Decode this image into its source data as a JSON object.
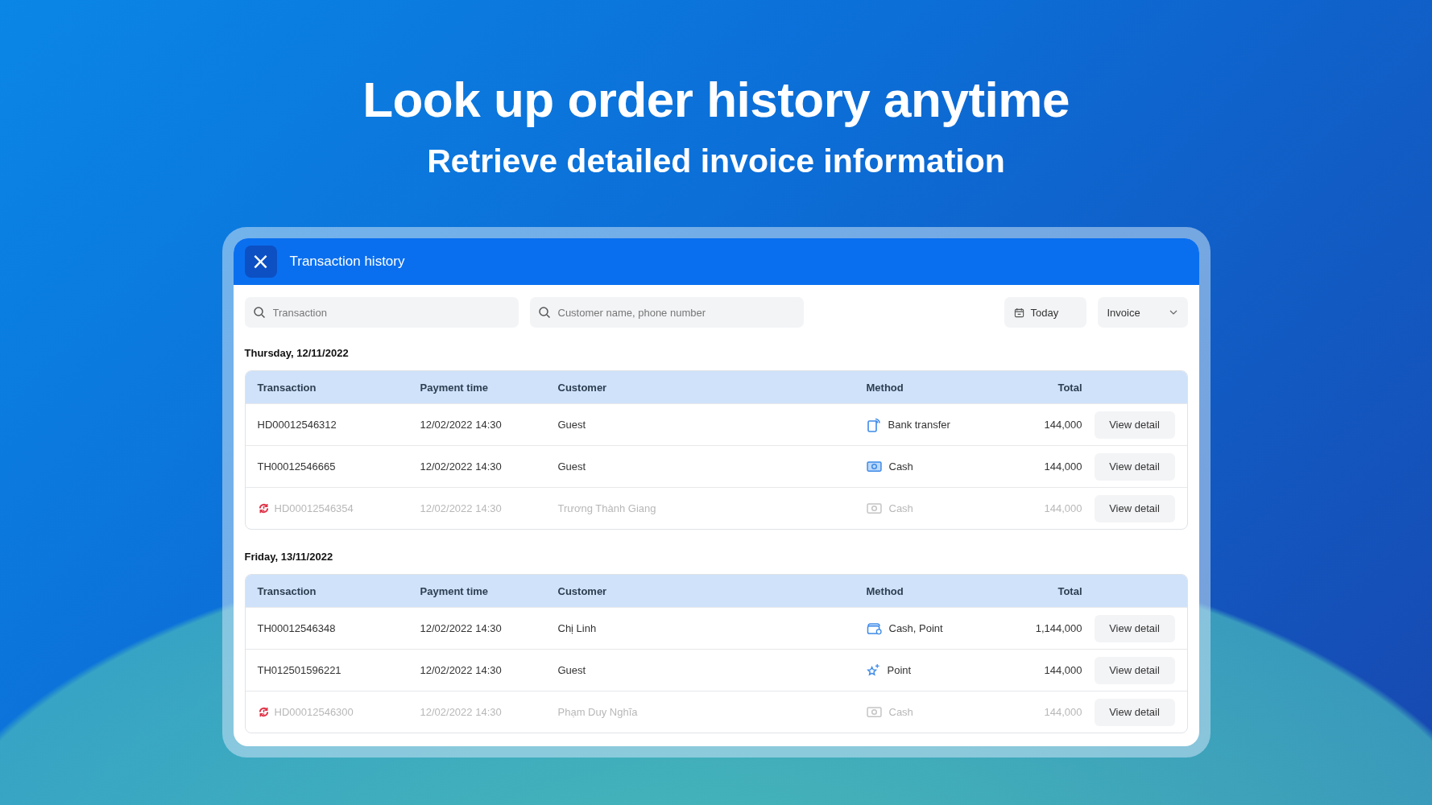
{
  "headline": "Look up order history anytime",
  "subheadline": "Retrieve detailed invoice information",
  "window": {
    "title": "Transaction history",
    "close_label": "×"
  },
  "filters": {
    "transaction_search": {
      "placeholder": "Transaction"
    },
    "customer_search": {
      "placeholder": "Customer name, phone number"
    },
    "date": "Today",
    "type": "Invoice"
  },
  "groups": [
    {
      "date": "Thursday, 12/11/2022",
      "columns": [
        "Transaction",
        "Payment time",
        "Customer",
        "Method",
        "Total"
      ],
      "rows": [
        {
          "id": "HD00012546312",
          "time": "12/02/2022 14:30",
          "customer": "Guest",
          "kind": "bank",
          "method": "Bank transfer",
          "total": "144,000",
          "returned": false,
          "action": "View detail"
        },
        {
          "id": "TH00012546665",
          "time": "12/02/2022 14:30",
          "customer": "Guest",
          "kind": "cash",
          "method": "Cash",
          "total": "144,000",
          "returned": false,
          "action": "View detail"
        },
        {
          "id": "HD00012546354",
          "time": "12/02/2022 14:30",
          "customer": "Trương Thành Giang",
          "kind": "cash",
          "method": "Cash",
          "total": "144,000",
          "returned": true,
          "action": "View detail"
        }
      ]
    },
    {
      "date": "Friday, 13/11/2022",
      "columns": [
        "Transaction",
        "Payment time",
        "Customer",
        "Method",
        "Total"
      ],
      "rows": [
        {
          "id": "TH00012546348",
          "time": "12/02/2022 14:30",
          "customer": "Chị Linh",
          "kind": "wallet",
          "method": "Cash, Point",
          "total": "1,144,000",
          "returned": false,
          "action": "View detail"
        },
        {
          "id": "TH012501596221",
          "time": "12/02/2022 14:30",
          "customer": "Guest",
          "kind": "point",
          "method": "Point",
          "total": "144,000",
          "returned": false,
          "action": "View detail"
        },
        {
          "id": "HD00012546300",
          "time": "12/02/2022 14:30",
          "customer": "Phạm Duy Nghĩa",
          "kind": "cash",
          "method": "Cash",
          "total": "144,000",
          "returned": true,
          "action": "View detail"
        }
      ]
    }
  ]
}
